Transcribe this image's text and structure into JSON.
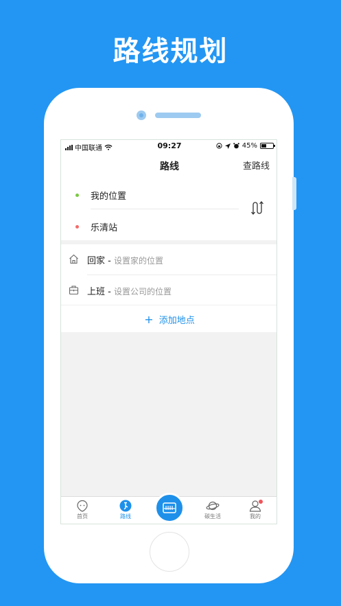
{
  "banner": {
    "title": "路线规划"
  },
  "status_bar": {
    "carrier": "中国联通",
    "time": "09:27",
    "battery": "45%",
    "battery_level": 0.45
  },
  "nav": {
    "title": "路线",
    "action_label": "查路线"
  },
  "route": {
    "start_label": "我的位置",
    "end_label": "乐清站",
    "start_color": "#7ac943",
    "end_color": "#f36b6b"
  },
  "places": [
    {
      "label": "回家",
      "separator": " - ",
      "hint": "设置家的位置",
      "icon": "home-icon"
    },
    {
      "label": "上班",
      "separator": " - ",
      "hint": "设置公司的位置",
      "icon": "briefcase-icon"
    }
  ],
  "add_place": {
    "icon": "plus-icon",
    "label": "添加地点"
  },
  "tabbar": {
    "items": [
      {
        "label": "首页",
        "icon": "home-chat-icon",
        "active": false
      },
      {
        "label": "路线",
        "icon": "route-icon",
        "active": true
      },
      {
        "label": "",
        "icon": "bus-card-icon",
        "active": false
      },
      {
        "label": "碳生活",
        "icon": "planet-icon",
        "active": false
      },
      {
        "label": "我的",
        "icon": "user-icon",
        "active": false,
        "badge": true
      }
    ]
  },
  "colors": {
    "background": "#2396f3",
    "accent": "#1e90ea"
  }
}
